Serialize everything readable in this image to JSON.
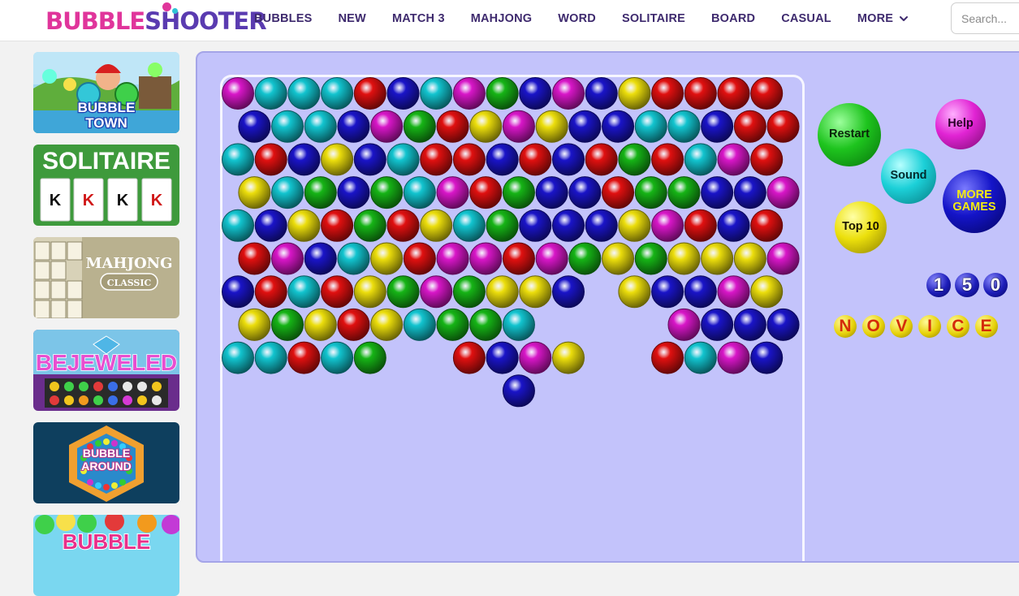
{
  "header": {
    "logo_part1": "BUBBLE",
    "logo_part2": "SHOOTER",
    "nav": [
      "BUBBLES",
      "NEW",
      "MATCH 3",
      "MAHJONG",
      "WORD",
      "SOLITAIRE",
      "BOARD",
      "CASUAL",
      "MORE"
    ],
    "search_placeholder": "Search..."
  },
  "sidebar": {
    "games": [
      {
        "title": "BUBBLE TOWN",
        "line1": "BUBBLE",
        "line2": "TOWN"
      },
      {
        "title": "SOLITAIRE",
        "cards": [
          "K",
          "K",
          "K",
          "K"
        ]
      },
      {
        "title": "MAHJONG",
        "subtitle": "CLASSIC"
      },
      {
        "title": "BEJEWELED"
      },
      {
        "title": "BUBBLE AROUND",
        "line1": "BUBBLE",
        "line2": "AROUND"
      },
      {
        "title": "BUBBLE"
      }
    ]
  },
  "game": {
    "buttons": {
      "restart": "Restart",
      "help": "Help",
      "sound": "Sound",
      "more_games": "MORE GAMES",
      "top10": "Top 10"
    },
    "score": "150",
    "level": "NOVICE",
    "grid": [
      "MCCCRBCMGBMBYRRRR",
      "BCCBMGRYMYBBCCBRR",
      "CRBYBCRRBRBRGRCMR",
      "YCGBGCMRGBBRGGBBM",
      "CBYRGRYCGBBBYMRBR",
      "RMBCYRMMRMGYGYYYM",
      "BRCRYGMGYYB.YBBMY",
      "YGYRYCGGC....MBBB",
      "CCRCG..RBMY..RCMB",
      "........B........"
    ],
    "colors": {
      "M": "#d816c8",
      "C": "#12c4cf",
      "R": "#e01010",
      "B": "#1a14c8",
      "G": "#16b416",
      "Y": "#ecde0c"
    }
  }
}
